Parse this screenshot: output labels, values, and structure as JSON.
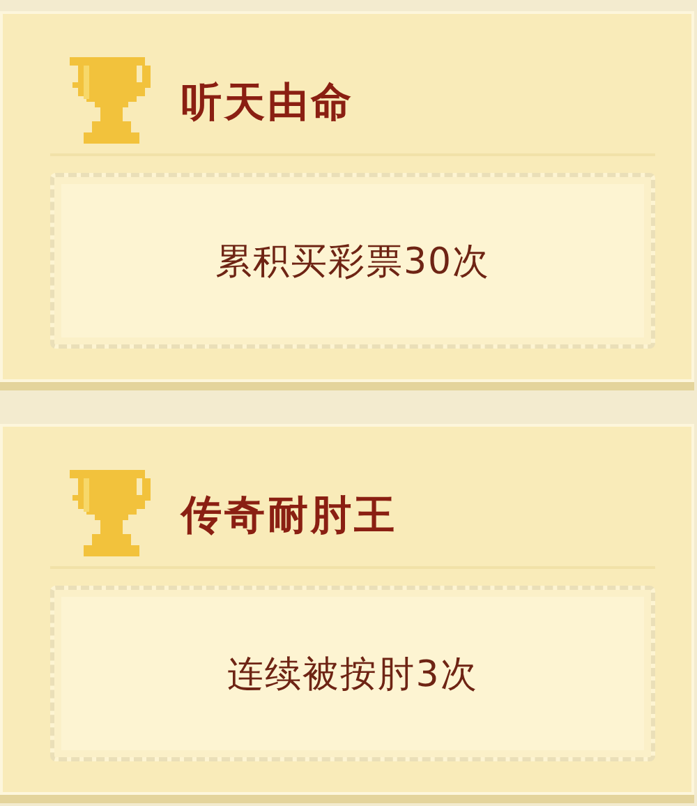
{
  "achievements": [
    {
      "title": "听天由命",
      "requirement": "累积买彩票30次"
    },
    {
      "title": "传奇耐肘王",
      "requirement": "连续被按肘3次"
    }
  ]
}
